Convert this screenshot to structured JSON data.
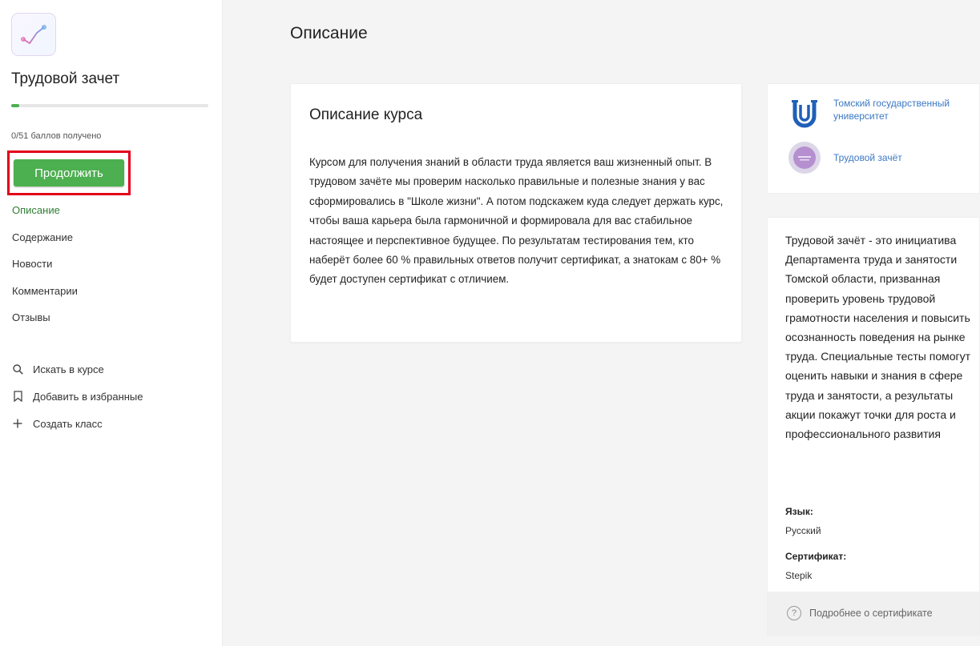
{
  "sidebar": {
    "course_title": "Трудовой зачет",
    "progress_fraction": 0.04,
    "score_text": "0/51 баллов получено",
    "continue_label": "Продолжить",
    "nav": [
      {
        "label": "Описание"
      },
      {
        "label": "Содержание"
      },
      {
        "label": "Новости"
      },
      {
        "label": "Комментарии"
      },
      {
        "label": "Отзывы"
      }
    ],
    "tools": [
      {
        "label": "Искать в курсе",
        "icon": "search-icon"
      },
      {
        "label": "Добавить в избранные",
        "icon": "bookmark-icon"
      },
      {
        "label": "Создать класс",
        "icon": "plus-icon"
      }
    ]
  },
  "main": {
    "page_title": "Описание",
    "card_title": "Описание курса",
    "card_text": "Курсом для получения знаний в области труда является ваш жизненный опыт. В трудовом зачёте мы проверим насколько правильные и полезные знания у вас сформировались в \"Школе жизни\". А потом подскажем куда следует держать курс, чтобы ваша карьера была гармоничной и формировала для вас стабильное настоящее и перспективное будущее. По результатам тестирования тем, кто наберёт более 60 % правильных ответов получит сертификат, а знатокам с 80+ % будет доступен сертификат с отличием."
  },
  "aside": {
    "authors": [
      {
        "name": "Томский государственный университет",
        "icon": "tsu-logo-icon"
      },
      {
        "name": "Трудовой зачёт",
        "icon": "labor-test-logo-icon"
      }
    ],
    "about": "Трудовой зачёт - это инициатива Департамента труда и занятости Томской области, призванная проверить уровень трудовой грамотности населения и повысить осознанность поведения на рынке труда. Специальные тесты помогут оценить навыки и знания в сфере труда и занятости, а результаты акции покажут точки для роста и профессионального развития",
    "language_label": "Язык:",
    "language_value": "Русский",
    "certificate_label": "Сертификат:",
    "certificate_value": "Stepik",
    "certificate_more": "Подробнее о сертификате"
  },
  "colors": {
    "accent": "#4caf50",
    "highlight": "#e3001b",
    "link": "#3b78c4"
  }
}
